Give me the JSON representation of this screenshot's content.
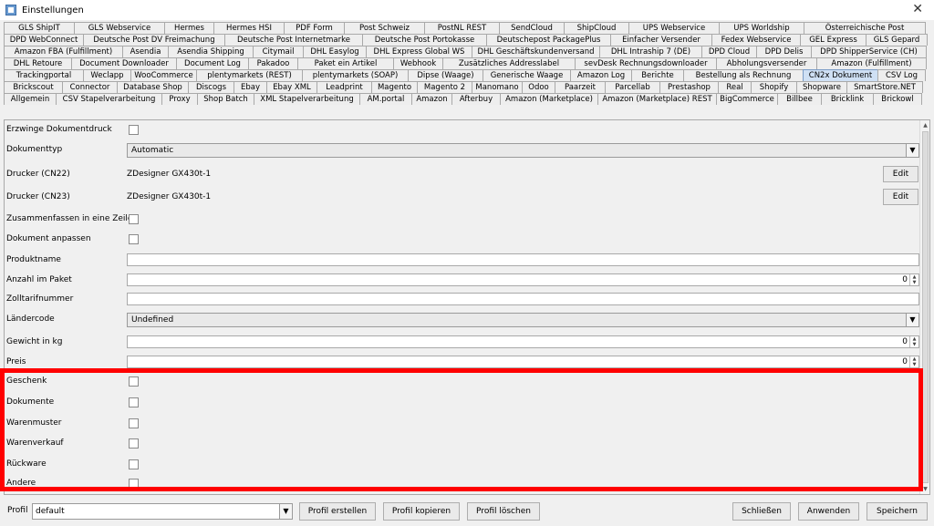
{
  "window": {
    "title": "Einstellungen",
    "close": "✕"
  },
  "tab_rows": [
    [
      "GLS ShipIT",
      "GLS Webservice",
      "Hermes",
      "Hermes HSI",
      "PDF Form",
      "Post Schweiz",
      "PostNL REST",
      "SendCloud",
      "ShipCloud",
      "UPS Webservice",
      "UPS Worldship",
      "Österreichische Post"
    ],
    [
      "DPD WebConnect",
      "Deutsche Post DV Freimachung",
      "Deutsche Post Internetmarke",
      "Deutsche Post Portokasse",
      "Deutschepost PackagePlus",
      "Einfacher Versender",
      "Fedex Webservice",
      "GEL Express",
      "GLS Gepard"
    ],
    [
      "Amazon FBA (Fulfillment)",
      "Asendia",
      "Asendia Shipping",
      "Citymail",
      "DHL Easylog",
      "DHL Express Global WS",
      "DHL Geschäftskundenversand",
      "DHL Intraship 7 (DE)",
      "DPD Cloud",
      "DPD Delis",
      "DPD ShipperService (CH)"
    ],
    [
      "DHL Retoure",
      "Document Downloader",
      "Document Log",
      "Pakadoo",
      "Paket ein Artikel",
      "Webhook",
      "Zusätzliches Addresslabel",
      "sevDesk Rechnungsdownloader",
      "Abholungsversender",
      "Amazon (Fulfillment)"
    ],
    [
      "Trackingportal",
      "Weclapp",
      "WooCommerce",
      "plentymarkets (REST)",
      "plentymarkets (SOAP)",
      "Dipse (Waage)",
      "Generische Waage",
      "Amazon Log",
      "Berichte",
      "Bestellung als Rechnung",
      "CN2x Dokument",
      "CSV Log"
    ],
    [
      "Brickscout",
      "Connector",
      "Database Shop",
      "Discogs",
      "Ebay",
      "Ebay XML",
      "Leadprint",
      "Magento",
      "Magento 2",
      "Manomano",
      "Odoo",
      "Paarzeit",
      "Parcellab",
      "Prestashop",
      "Real",
      "Shopify",
      "Shopware",
      "SmartStore.NET"
    ],
    [
      "Allgemein",
      "CSV Stapelverarbeitung",
      "Proxy",
      "Shop Batch",
      "XML Stapelverarbeitung",
      "AM.portal",
      "Amazon",
      "Afterbuy",
      "Amazon (Marketplace)",
      "Amazon (Marketplace) REST",
      "BigCommerce",
      "Billbee",
      "Bricklink",
      "Brickowl"
    ]
  ],
  "active_tab": "CN2x Dokument",
  "form": {
    "erzwinge_label": "Erzwinge Dokumentdruck",
    "dokumenttyp_label": "Dokumenttyp",
    "dokumenttyp_value": "Automatic",
    "drucker_cn22_label": "Drucker (CN22)",
    "drucker_cn22_value": "ZDesigner GX430t-1",
    "drucker_cn23_label": "Drucker (CN23)",
    "drucker_cn23_value": "ZDesigner GX430t-1",
    "edit_label": "Edit",
    "zusammenfassen_label": "Zusammenfassen in eine Zeile",
    "dokument_anpassen_label": "Dokument anpassen",
    "produktname_label": "Produktname",
    "anzahl_label": "Anzahl im Paket",
    "anzahl_value": "0",
    "zolltarif_label": "Zolltarifnummer",
    "laendercode_label": "Ländercode",
    "laendercode_value": "Undefined",
    "gewicht_label": "Gewicht in kg",
    "gewicht_value": "0",
    "preis_label": "Preis",
    "preis_value": "0",
    "geschenk_label": "Geschenk",
    "dokumente_label": "Dokumente",
    "warenmuster_label": "Warenmuster",
    "warenverkauf_label": "Warenverkauf",
    "rueckware_label": "Rückware",
    "andere_label": "Andere"
  },
  "footer": {
    "profil_label": "Profil",
    "profil_value": "default",
    "profil_erstellen": "Profil erstellen",
    "profil_kopieren": "Profil kopieren",
    "profil_loeschen": "Profil löschen",
    "schliessen": "Schließen",
    "anwenden": "Anwenden",
    "speichern": "Speichern"
  },
  "highlight_color": "#ff0000"
}
